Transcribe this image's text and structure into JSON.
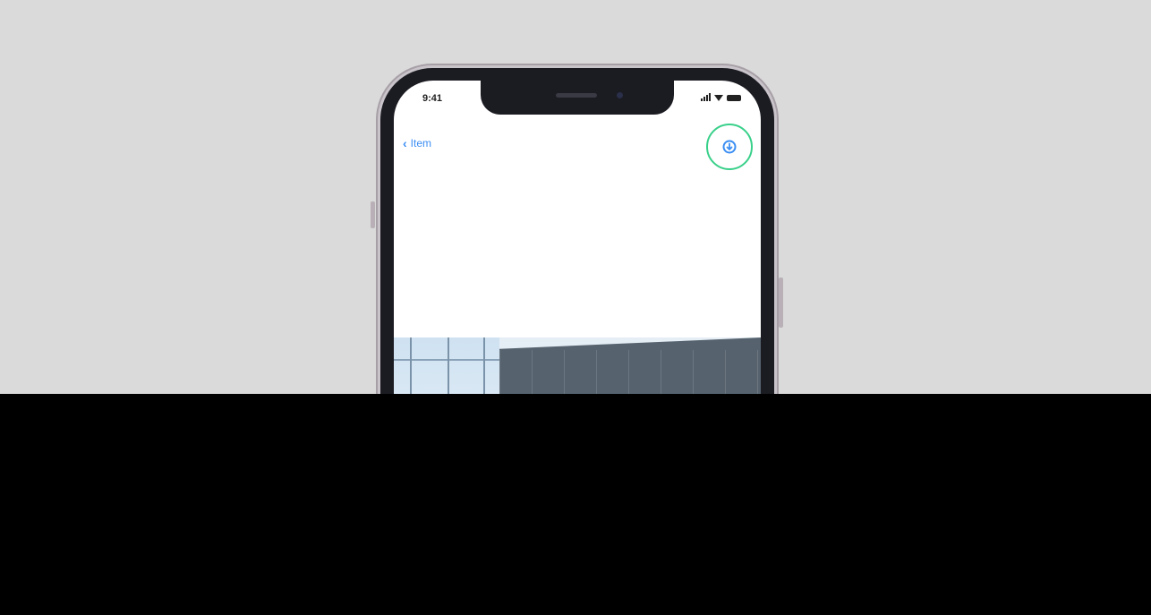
{
  "status_bar": {
    "time": "9:41",
    "icons": [
      "signal-icon",
      "wifi-icon",
      "battery-icon"
    ]
  },
  "nav": {
    "back_label": "Item",
    "back_icon": "chevron-left-icon",
    "action_icon": "download-icon"
  },
  "colors": {
    "accent": "#3b8ef3",
    "highlight": "#39d08a",
    "background": "#dadada",
    "overlay": "#000000"
  }
}
